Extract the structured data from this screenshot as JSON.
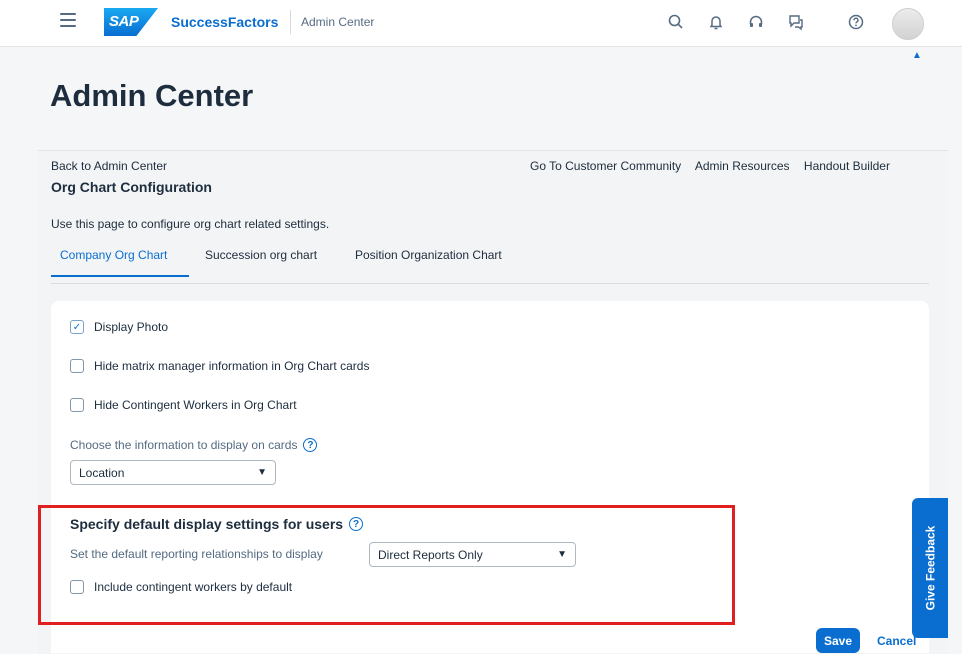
{
  "shell": {
    "logo_text": "SAP",
    "product_name": "SuccessFactors",
    "page_context": "Admin Center",
    "icons": [
      "menu-icon",
      "search-icon",
      "bell-icon",
      "headset-icon",
      "chat-icon",
      "help-icon",
      "avatar"
    ]
  },
  "page": {
    "title": "Admin Center"
  },
  "header": {
    "back_link": "Back to Admin Center",
    "config_title": "Org Chart Configuration",
    "links": [
      "Go To Customer Community",
      "Admin Resources",
      "Handout Builder"
    ]
  },
  "description": "Use this page to configure org chart related settings.",
  "tabs": [
    {
      "label": "Company Org Chart",
      "active": true
    },
    {
      "label": "Succession org chart",
      "active": false
    },
    {
      "label": "Position Organization Chart",
      "active": false
    }
  ],
  "settings": {
    "display_photo": {
      "label": "Display Photo",
      "checked": true
    },
    "hide_matrix": {
      "label": "Hide matrix manager information in Org Chart cards",
      "checked": false
    },
    "hide_contingent": {
      "label": "Hide Contingent Workers in Org Chart",
      "checked": false
    },
    "card_info_label": "Choose the information to display on cards",
    "card_info_value": "Location"
  },
  "defaults": {
    "title": "Specify default display settings for users",
    "reporting_label": "Set the default reporting relationships to display",
    "reporting_value": "Direct Reports Only",
    "include_contingent": {
      "label": "Include contingent workers by default",
      "checked": false
    }
  },
  "feedback": {
    "label": "Give Feedback"
  },
  "actions": {
    "save": "Save",
    "cancel": "Cancel"
  },
  "colors": {
    "accent": "#0a6ed1",
    "highlight": "#e02020"
  }
}
